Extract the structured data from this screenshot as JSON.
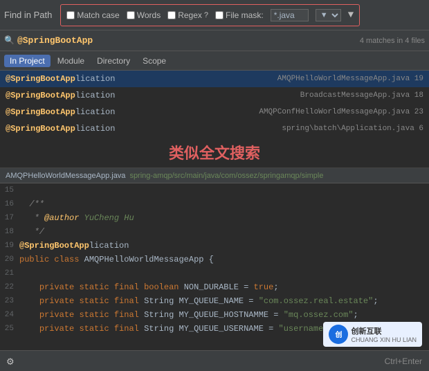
{
  "toolbar": {
    "title": "Find in Path",
    "match_case_label": "Match case",
    "words_label": "Words",
    "regex_label": "Regex",
    "regex_help": "?",
    "file_mask_label": "File mask:",
    "file_mask_value": "*.java",
    "filter_icon": "▼",
    "gear_icon": "⚙"
  },
  "search": {
    "placeholder": "@SpringBootApp",
    "value": "@SpringBootApp",
    "match_count": "4 matches in 4 files"
  },
  "tabs": [
    {
      "label": "In Project",
      "active": true
    },
    {
      "label": "Module",
      "active": false
    },
    {
      "label": "Directory",
      "active": false
    },
    {
      "label": "Scope",
      "active": false
    }
  ],
  "results": [
    {
      "prefix": "@SpringBootApp",
      "suffix": "lication",
      "filename": "AMQPHelloWorldMessageApp.java",
      "line": "19",
      "selected": true
    },
    {
      "prefix": "@SpringBootApp",
      "suffix": "lication",
      "filename": "BroadcastMessageApp.java",
      "line": "18",
      "selected": false
    },
    {
      "prefix": "@SpringBootApp",
      "suffix": "lication",
      "filename": "AMQPConfHelloWorldMessageApp.java",
      "line": "23",
      "selected": false
    },
    {
      "prefix": "@SpringBootApp",
      "suffix": "lication",
      "filename": "spring\\batch\\Application.java",
      "line": "6",
      "selected": false
    }
  ],
  "overlay_text": "类似全文搜索",
  "code_preview": {
    "filename": "AMQPHelloWorldMessageApp.java",
    "path": "spring-amqp/src/main/java/com/ossez/springamqp/simple",
    "lines": [
      {
        "num": "15",
        "content": ""
      },
      {
        "num": "16",
        "content": "  /**",
        "type": "comment"
      },
      {
        "num": "17",
        "content": "   * @author YuCheng Hu",
        "type": "author"
      },
      {
        "num": "18",
        "content": "   */",
        "type": "comment"
      },
      {
        "num": "19",
        "content": "@SpringBootApplication",
        "type": "annotation"
      },
      {
        "num": "20",
        "content": "public class AMQPHelloWorldMessageApp {",
        "type": "class"
      },
      {
        "num": "21",
        "content": ""
      },
      {
        "num": "22",
        "content": "    private static final boolean NON_DURABLE = true;",
        "type": "field"
      },
      {
        "num": "23",
        "content": "    private static final String MY_QUEUE_NAME = \"com.ossez.real.estate\";",
        "type": "field_truncated"
      },
      {
        "num": "24",
        "content": "    private static final String MY_QUEUE_HOSTNAMME = \"mq.ossez.com\";",
        "type": "field"
      },
      {
        "num": "25",
        "content": "    private static final String MY_QUEUE_USERNAME = \"username...",
        "type": "field_truncated"
      }
    ]
  },
  "bottom_bar": {
    "settings_icon": "⚙",
    "shortcut": "Ctrl+Enter"
  },
  "watermark": {
    "logo_text": "创",
    "brand": "创新互联",
    "sub": "CHUANG XIN HU LIAN"
  }
}
